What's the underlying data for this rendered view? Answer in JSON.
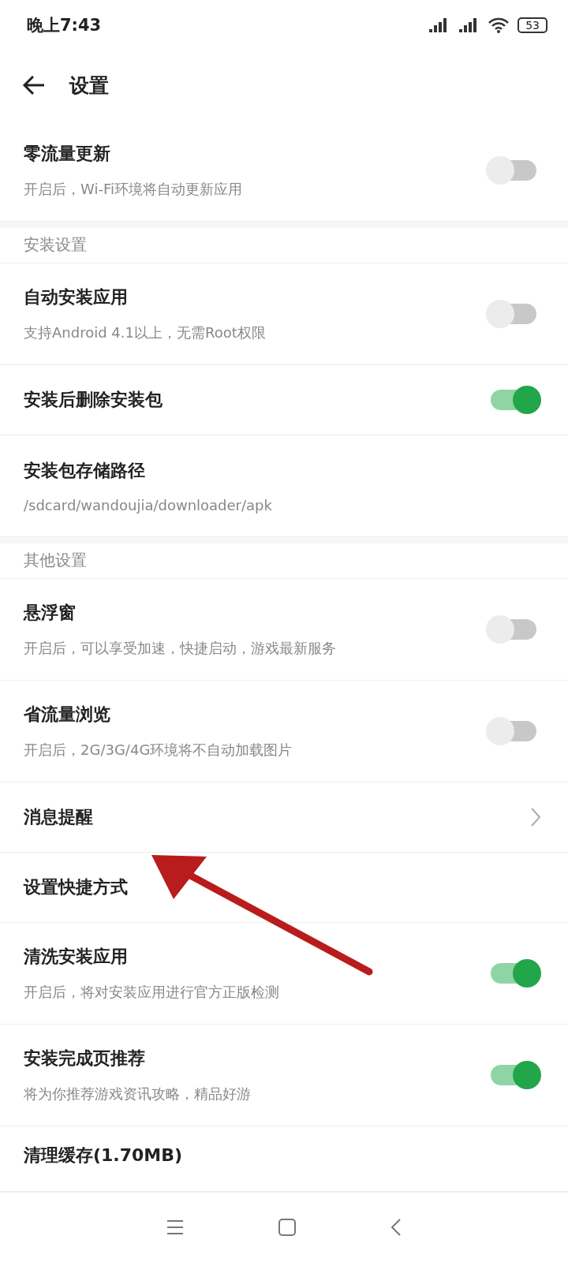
{
  "status_bar": {
    "time": "晚上7:43",
    "battery": "53"
  },
  "header": {
    "title": "设置"
  },
  "sections": [
    {
      "items": [
        {
          "kind": "toggle",
          "title": "零流量更新",
          "subtitle": "开启后，Wi-Fi环境将自动更新应用",
          "on": false
        }
      ]
    },
    {
      "header": "安装设置",
      "items": [
        {
          "kind": "toggle",
          "title": "自动安装应用",
          "subtitle": "支持Android 4.1以上，无需Root权限",
          "on": false
        },
        {
          "kind": "toggle",
          "title": "安装后删除安装包",
          "on": true
        },
        {
          "kind": "plain",
          "title": "安装包存储路径",
          "subtitle": "/sdcard/wandoujia/downloader/apk"
        }
      ]
    },
    {
      "header": "其他设置",
      "items": [
        {
          "kind": "toggle",
          "title": "悬浮窗",
          "subtitle": "开启后，可以享受加速，快捷启动，游戏最新服务",
          "on": false
        },
        {
          "kind": "toggle",
          "title": "省流量浏览",
          "subtitle": "开启后，2G/3G/4G环境将不自动加载图片",
          "on": false
        },
        {
          "kind": "chevron",
          "title": "消息提醒"
        },
        {
          "kind": "plain",
          "title": "设置快捷方式"
        },
        {
          "kind": "toggle",
          "title": "清洗安装应用",
          "subtitle": "开启后，将对安装应用进行官方正版检测",
          "on": true
        },
        {
          "kind": "toggle",
          "title": "安装完成页推荐",
          "subtitle": "将为你推荐游戏资讯攻略，精品好游",
          "on": true
        },
        {
          "kind": "cut",
          "title": "清理缓存(1.70MB)"
        }
      ]
    }
  ]
}
